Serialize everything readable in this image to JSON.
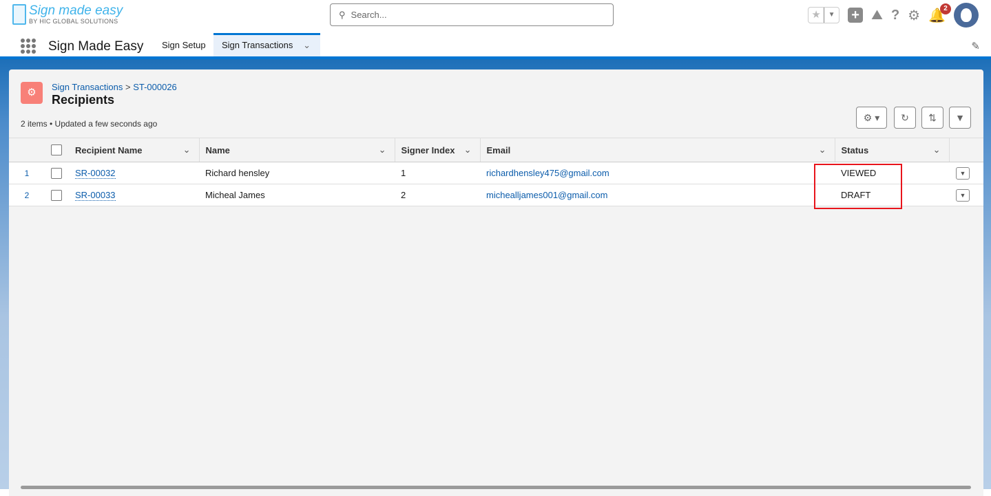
{
  "logo": {
    "title": "Sign made easy",
    "subtitle": "BY HIC GLOBAL SOLUTIONS"
  },
  "search": {
    "placeholder": "Search..."
  },
  "header": {
    "notification_count": "2"
  },
  "nav": {
    "app_name": "Sign Made Easy",
    "tabs": [
      {
        "label": "Sign Setup"
      },
      {
        "label": "Sign Transactions"
      }
    ]
  },
  "page": {
    "breadcrumb": [
      "Sign Transactions",
      "ST-000026"
    ],
    "breadcrumb_sep": ">",
    "title": "Recipients",
    "meta": "2 items • Updated a few seconds ago"
  },
  "table": {
    "columns": [
      "Recipient Name",
      "Name",
      "Signer Index",
      "Email",
      "Status"
    ],
    "rows": [
      {
        "num": "1",
        "id": "SR-00032",
        "name": "Richard hensley",
        "signer_index": "1",
        "email": "richardhensley475@gmail.com",
        "status": "VIEWED"
      },
      {
        "num": "2",
        "id": "SR-00033",
        "name": "Micheal James",
        "signer_index": "2",
        "email": "michealljames001@gmail.com",
        "status": "DRAFT"
      }
    ]
  },
  "colors": {
    "brand": "#0176d3",
    "highlight": "#e8141b"
  }
}
